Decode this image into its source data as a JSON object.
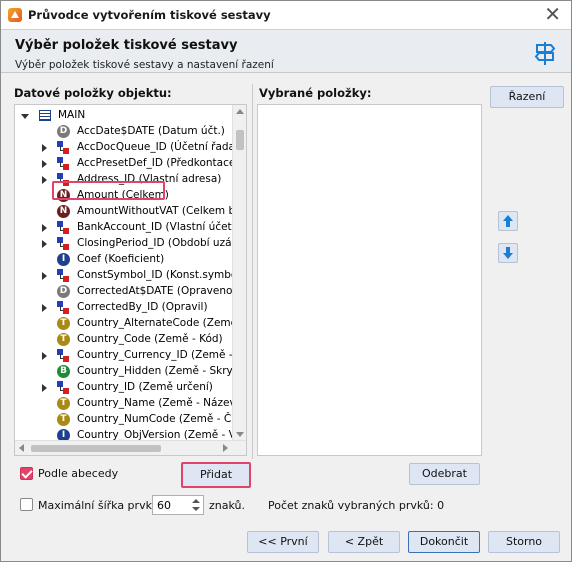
{
  "window": {
    "title": "Průvodce vytvořením tiskové sestavy"
  },
  "header": {
    "title": "Výběr položek tiskové sestavy",
    "subtitle": "Výběr položek tiskové sestavy a nastavení řazení"
  },
  "left_panel": {
    "label": "Datové položky objektu:",
    "root": "MAIN",
    "items": [
      {
        "icon": "D",
        "expandable": false,
        "text": "AccDate$DATE (Datum účt.)"
      },
      {
        "icon": "rel",
        "expandable": true,
        "text": "AccDocQueue_ID (Účetní řada)"
      },
      {
        "icon": "rel",
        "expandable": true,
        "text": "AccPresetDef_ID (Předkontace)"
      },
      {
        "icon": "rel",
        "expandable": true,
        "text": "Address_ID (Vlastní adresa)"
      },
      {
        "icon": "N",
        "expandable": false,
        "text": "Amount (Celkem)",
        "highlighted": true
      },
      {
        "icon": "N",
        "expandable": false,
        "text": "AmountWithoutVAT (Celkem bez"
      },
      {
        "icon": "rel",
        "expandable": true,
        "text": "BankAccount_ID (Vlastní účet)"
      },
      {
        "icon": "rel",
        "expandable": true,
        "text": "ClosingPeriod_ID (Období uzávě"
      },
      {
        "icon": "I",
        "expandable": false,
        "text": "Coef (Koeficient)"
      },
      {
        "icon": "rel",
        "expandable": true,
        "text": "ConstSymbol_ID (Konst.symbol)"
      },
      {
        "icon": "D",
        "expandable": false,
        "text": "CorrectedAt$DATE (Opraveno)"
      },
      {
        "icon": "rel",
        "expandable": true,
        "text": "CorrectedBy_ID (Opravil)"
      },
      {
        "icon": "T",
        "expandable": false,
        "text": "Country_AlternateCode (Země -"
      },
      {
        "icon": "T",
        "expandable": false,
        "text": "Country_Code (Země - Kód)"
      },
      {
        "icon": "rel",
        "expandable": true,
        "text": "Country_Currency_ID (Země - M"
      },
      {
        "icon": "B",
        "expandable": false,
        "text": "Country_Hidden (Země - Skrytý"
      },
      {
        "icon": "rel",
        "expandable": true,
        "text": "Country_ID (Země určení)"
      },
      {
        "icon": "T",
        "expandable": false,
        "text": "Country_Name (Země - Název)"
      },
      {
        "icon": "T",
        "expandable": false,
        "text": "Country_NumCode (Země - Číse"
      },
      {
        "icon": "I",
        "expandable": false,
        "text": "Country_ObjVersion (Země - Ver"
      }
    ]
  },
  "right_panel": {
    "label": "Vybrané položky:"
  },
  "buttons": {
    "sort": "Řazení",
    "add": "Přidat",
    "remove": "Odebrat",
    "first": "<< První",
    "back": "< Zpět",
    "finish": "Dokončit",
    "cancel": "Storno"
  },
  "options": {
    "alphabetical_label": "Podle abecedy",
    "alphabetical_checked": true,
    "max_width_label": "Maximální šířka prvků:",
    "max_width_checked": false,
    "max_width_value": "60",
    "chars_label": "znaků.",
    "char_count_label": "Počet znaků vybraných prvků: 0"
  },
  "colors": {
    "highlight": "#e0436b",
    "button_bg": "#dde6f2",
    "arrow": "#1a7fd4"
  }
}
